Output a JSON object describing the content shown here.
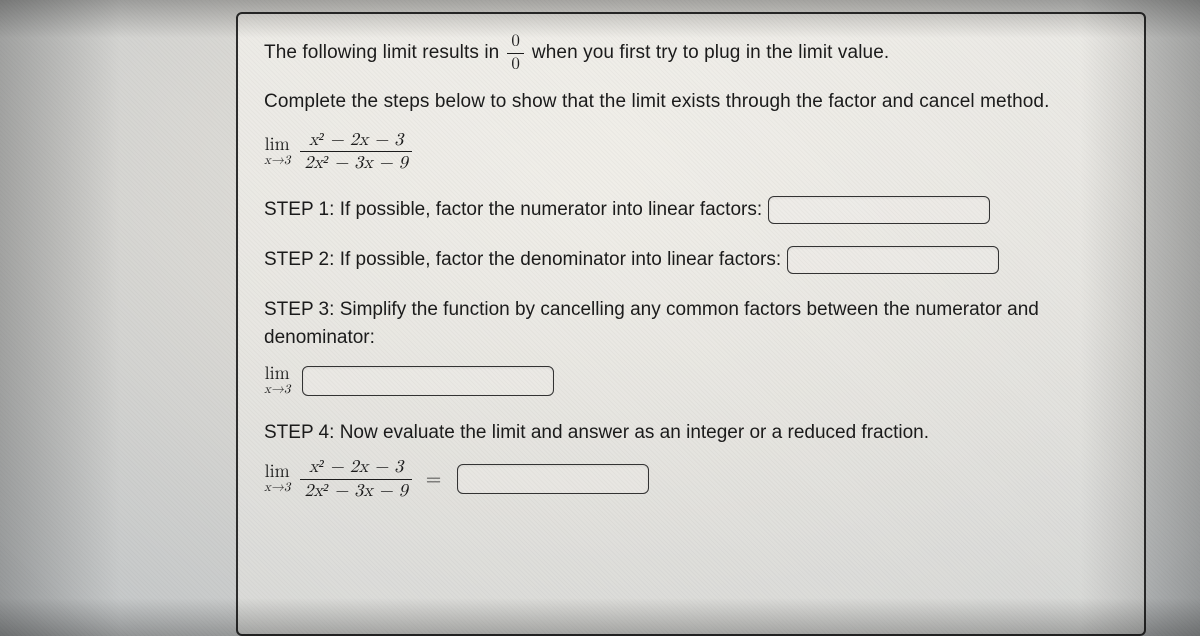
{
  "intro1a": "The following limit results in",
  "intro_frac_n": "0",
  "intro_frac_d": "0",
  "intro1b": "when you first try to plug in the limit value.",
  "intro2": "Complete the steps below to show that the limit exists through the factor and cancel method.",
  "limit": {
    "lim": "lim",
    "sub": "x→3",
    "num": "x² − 2x − 3",
    "den": "2x² − 3x − 9"
  },
  "step1_label": "STEP 1:",
  "step1_text": "If possible, factor the numerator into linear factors:",
  "step2_label": "STEP 2:",
  "step2_text": "If possible, factor the denominator into linear factors:",
  "step3_label": "STEP 3:",
  "step3_text_a": "Simplify the function by cancelling any common factors between the numerator and",
  "step3_text_b": "denominator:",
  "step4_label": "STEP 4:",
  "step4_text": "Now evaluate the limit and answer as an integer or a reduced fraction.",
  "equals": "="
}
